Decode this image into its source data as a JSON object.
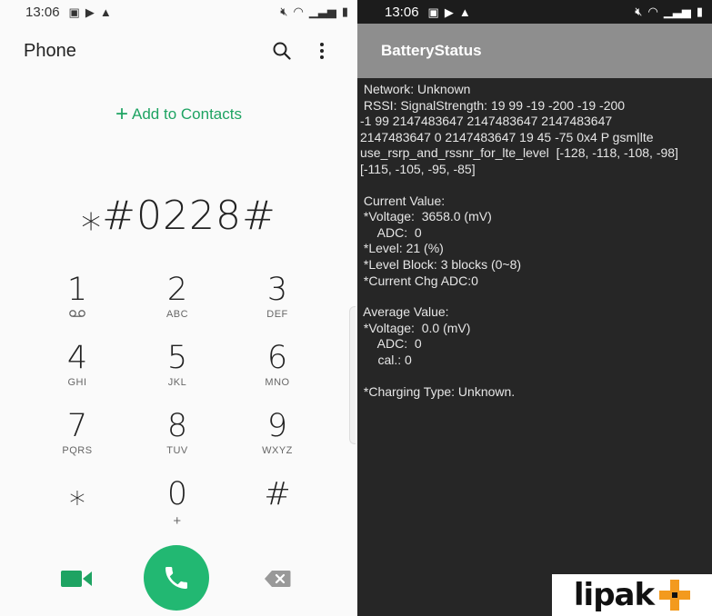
{
  "left": {
    "status": {
      "time": "13:06"
    },
    "appbar": {
      "title": "Phone"
    },
    "add_contacts": {
      "label": "Add to Contacts"
    },
    "dialed_number": "⁎#0228#",
    "keys": [
      {
        "digit": "1",
        "sub": ""
      },
      {
        "digit": "2",
        "sub": "ABC"
      },
      {
        "digit": "3",
        "sub": "DEF"
      },
      {
        "digit": "4",
        "sub": "GHI"
      },
      {
        "digit": "5",
        "sub": "JKL"
      },
      {
        "digit": "6",
        "sub": "MNO"
      },
      {
        "digit": "7",
        "sub": "PQRS"
      },
      {
        "digit": "8",
        "sub": "TUV"
      },
      {
        "digit": "9",
        "sub": "WXYZ"
      },
      {
        "digit": "⁎",
        "sub": ""
      },
      {
        "digit": "0",
        "sub": "+"
      },
      {
        "digit": "#",
        "sub": ""
      }
    ],
    "colors": {
      "accent": "#1ea362",
      "call": "#22b872"
    }
  },
  "right": {
    "status": {
      "time": "13:06"
    },
    "appbar": {
      "title": "BatteryStatus"
    },
    "lines": [
      " Network: Unknown",
      " RSSI: SignalStrength: 19 99 -19 -200 -19 -200",
      "-1 99 2147483647 2147483647 2147483647",
      "2147483647 0 2147483647 19 45 -75 0x4 P gsm|lte",
      "use_rsrp_and_rssnr_for_lte_level  [-128, -118, -108, -98]",
      "[-115, -105, -95, -85]",
      "",
      " Current Value:",
      " *Voltage:  3658.0 (mV)",
      "     ADC:  0",
      " *Level: 21 (%)",
      " *Level Block: 3 blocks (0~8)",
      " *Current Chg ADC:0",
      "",
      " Average Value:",
      " *Voltage:  0.0 (mV)",
      "     ADC:  0",
      "     cal.: 0",
      "",
      " *Charging Type: Unknown."
    ],
    "colors": {
      "appbar": "#8e8e8e",
      "background": "#262626"
    }
  },
  "watermark": {
    "text": "lipak"
  }
}
